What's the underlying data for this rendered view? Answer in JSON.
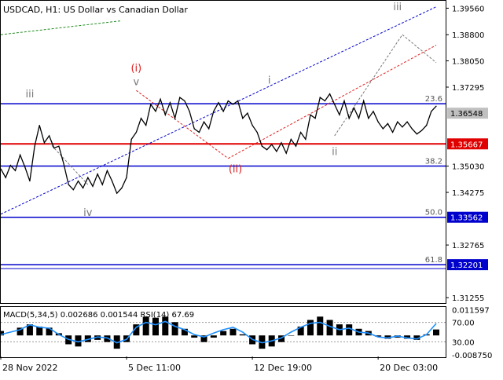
{
  "header": {
    "symbol_line": "USDCAD, H1:  US Dollar vs Canadian Dollar"
  },
  "colors": {
    "price_line": "#000000",
    "red_level": "#e00000",
    "blue_level": "#0000cc",
    "wave_red": "#dd2222",
    "wave_grey": "#777777",
    "channel_blue": "#0000cc",
    "fib_label": "#555555",
    "macd_hist": "#000000",
    "rsi_line": "#1e90ff"
  },
  "chart_data": [
    {
      "type": "line",
      "title": "USDCAD, H1:  US Dollar vs Canadian Dollar",
      "ylim": [
        1.311,
        1.3975
      ],
      "xlabel": "",
      "ylabel": "",
      "grid": false,
      "y_ticks": [
        "1.39560",
        "1.38800",
        "1.38050",
        "1.37295",
        "1.36548",
        "1.35667",
        "1.35030",
        "1.34275",
        "1.33562",
        "1.32765",
        "1.32201",
        "1.31255"
      ],
      "y_tick_values": [
        1.3956,
        1.388,
        1.3805,
        1.37295,
        1.36548,
        1.35667,
        1.3503,
        1.34275,
        1.33562,
        1.32765,
        1.32201,
        1.31255
      ],
      "highlighted_prices": [
        {
          "label": "1.36548",
          "value": 1.36548,
          "style": "current",
          "color": "#c0c0c0"
        },
        {
          "label": "1.35667",
          "value": 1.35667,
          "style": "level",
          "color": "#e00000"
        },
        {
          "label": "1.33562",
          "value": 1.33562,
          "style": "level",
          "color": "#0000cc"
        },
        {
          "label": "1.32201",
          "value": 1.32201,
          "style": "level",
          "color": "#0000cc"
        }
      ],
      "x_ticks": [
        "28 Nov 2022",
        "5 Dec 11:00",
        "12 Dec 19:00",
        "20 Dec 03:00"
      ],
      "x_tick_positions": [
        0,
        0.26,
        0.52,
        0.78
      ],
      "series": [
        {
          "values": [
            [
              0.0,
              1.3495
            ],
            [
              0.01,
              1.347
            ],
            [
              0.02,
              1.3505
            ],
            [
              0.03,
              1.349
            ],
            [
              0.04,
              1.3535
            ],
            [
              0.05,
              1.35
            ],
            [
              0.06,
              1.346
            ],
            [
              0.07,
              1.356
            ],
            [
              0.08,
              1.362
            ],
            [
              0.09,
              1.357
            ],
            [
              0.1,
              1.359
            ],
            [
              0.11,
              1.3555
            ],
            [
              0.12,
              1.356
            ],
            [
              0.13,
              1.351
            ],
            [
              0.14,
              1.345
            ],
            [
              0.15,
              1.3435
            ],
            [
              0.16,
              1.346
            ],
            [
              0.17,
              1.344
            ],
            [
              0.18,
              1.347
            ],
            [
              0.19,
              1.3445
            ],
            [
              0.2,
              1.348
            ],
            [
              0.21,
              1.345
            ],
            [
              0.22,
              1.349
            ],
            [
              0.23,
              1.346
            ],
            [
              0.24,
              1.3425
            ],
            [
              0.25,
              1.344
            ],
            [
              0.26,
              1.347
            ],
            [
              0.27,
              1.358
            ],
            [
              0.28,
              1.36
            ],
            [
              0.29,
              1.364
            ],
            [
              0.3,
              1.362
            ],
            [
              0.31,
              1.368
            ],
            [
              0.32,
              1.366
            ],
            [
              0.33,
              1.3695
            ],
            [
              0.34,
              1.365
            ],
            [
              0.35,
              1.3685
            ],
            [
              0.36,
              1.364
            ],
            [
              0.37,
              1.37
            ],
            [
              0.38,
              1.369
            ],
            [
              0.39,
              1.366
            ],
            [
              0.4,
              1.361
            ],
            [
              0.41,
              1.36
            ],
            [
              0.42,
              1.363
            ],
            [
              0.43,
              1.361
            ],
            [
              0.44,
              1.366
            ],
            [
              0.45,
              1.3685
            ],
            [
              0.46,
              1.366
            ],
            [
              0.47,
              1.369
            ],
            [
              0.48,
              1.368
            ],
            [
              0.49,
              1.369
            ],
            [
              0.5,
              1.364
            ],
            [
              0.51,
              1.3655
            ],
            [
              0.52,
              1.362
            ],
            [
              0.53,
              1.36
            ],
            [
              0.54,
              1.356
            ],
            [
              0.55,
              1.355
            ],
            [
              0.56,
              1.3565
            ],
            [
              0.57,
              1.3545
            ],
            [
              0.58,
              1.357
            ],
            [
              0.59,
              1.354
            ],
            [
              0.6,
              1.358
            ],
            [
              0.61,
              1.356
            ],
            [
              0.62,
              1.36
            ],
            [
              0.63,
              1.358
            ],
            [
              0.64,
              1.365
            ],
            [
              0.65,
              1.364
            ],
            [
              0.66,
              1.37
            ],
            [
              0.67,
              1.369
            ],
            [
              0.68,
              1.371
            ],
            [
              0.69,
              1.368
            ],
            [
              0.7,
              1.365
            ],
            [
              0.71,
              1.369
            ],
            [
              0.72,
              1.364
            ],
            [
              0.73,
              1.367
            ],
            [
              0.74,
              1.364
            ],
            [
              0.75,
              1.369
            ],
            [
              0.76,
              1.364
            ],
            [
              0.77,
              1.366
            ],
            [
              0.78,
              1.363
            ],
            [
              0.79,
              1.361
            ],
            [
              0.8,
              1.3625
            ],
            [
              0.81,
              1.36
            ],
            [
              0.82,
              1.363
            ],
            [
              0.83,
              1.3615
            ],
            [
              0.84,
              1.363
            ],
            [
              0.85,
              1.361
            ],
            [
              0.86,
              1.3595
            ],
            [
              0.87,
              1.3605
            ],
            [
              0.88,
              1.362
            ],
            [
              0.89,
              1.366
            ],
            [
              0.9,
              1.3675
            ]
          ]
        }
      ],
      "fib_levels": [
        {
          "label": "23.6",
          "value": 1.3682
        },
        {
          "label": "38.2",
          "value": 1.3503
        },
        {
          "label": "50.0",
          "value": 1.33562
        },
        {
          "label": "61.8",
          "value": 1.32201
        }
      ],
      "horizontal_levels": [
        {
          "value": 1.35667,
          "color": "#e00000"
        },
        {
          "value": 1.33562,
          "color": "#0000cc"
        },
        {
          "value": 1.32201,
          "color": "#0000cc"
        },
        {
          "value": 1.3682,
          "color": "#0000cc"
        },
        {
          "value": 1.3503,
          "color": "#0000cc"
        }
      ],
      "wave_labels": [
        {
          "text": "iii",
          "x": 0.06,
          "y": 1.37,
          "color": "#777777"
        },
        {
          "text": "iv",
          "x": 0.18,
          "y": 1.336,
          "color": "#777777"
        },
        {
          "text": "(i)",
          "x": 0.28,
          "y": 1.3775,
          "color": "#dd2222"
        },
        {
          "text": "v",
          "x": 0.28,
          "y": 1.3735,
          "color": "#777777"
        },
        {
          "text": "(ii)",
          "x": 0.485,
          "y": 1.3485,
          "color": "#dd2222"
        },
        {
          "text": "i",
          "x": 0.555,
          "y": 1.374,
          "color": "#777777"
        },
        {
          "text": "ii",
          "x": 0.69,
          "y": 1.3535,
          "color": "#777777"
        },
        {
          "text": "iii",
          "x": 0.82,
          "y": 1.395,
          "color": "#777777"
        }
      ],
      "trend_lines": [
        {
          "from": [
            0.0,
            1.3365
          ],
          "to": [
            0.9,
            1.396
          ],
          "color": "#0000cc",
          "dash": true
        },
        {
          "from": [
            0.47,
            1.3525
          ],
          "to": [
            0.9,
            1.385
          ],
          "color": "#dd2222",
          "dash": true
        },
        {
          "from": [
            0.0,
            1.388
          ],
          "to": [
            0.25,
            1.392
          ],
          "color": "#228b22",
          "dash": true
        },
        {
          "from": [
            0.28,
            1.372
          ],
          "to": [
            0.47,
            1.3525
          ],
          "color": "#dd2222",
          "dash": true
        },
        {
          "from": [
            0.69,
            1.359
          ],
          "to": [
            0.83,
            1.388
          ],
          "color": "#777777",
          "dash": true
        },
        {
          "from": [
            0.83,
            1.388
          ],
          "to": [
            0.9,
            1.38
          ],
          "color": "#777777",
          "dash": true
        },
        {
          "from": [
            0.1,
            1.357
          ],
          "to": [
            0.18,
            1.345
          ],
          "color": "#777777",
          "dash": true
        }
      ]
    },
    {
      "type": "line",
      "title": "MACD(5,34,5) 0.002686 0.001544 RSI(14) 67.69",
      "ylim": [
        -0.0095,
        0.0125
      ],
      "y_ticks": [
        "0.011597",
        "70.00",
        "30.00",
        "-0.008750"
      ],
      "rsi_levels": [
        70,
        30
      ],
      "series": [
        {
          "name": "RSI(14)",
          "values": [
            [
              0.0,
              45
            ],
            [
              0.04,
              55
            ],
            [
              0.06,
              65
            ],
            [
              0.08,
              60
            ],
            [
              0.1,
              58
            ],
            [
              0.12,
              45
            ],
            [
              0.14,
              35
            ],
            [
              0.16,
              30
            ],
            [
              0.18,
              35
            ],
            [
              0.2,
              40
            ],
            [
              0.22,
              38
            ],
            [
              0.24,
              28
            ],
            [
              0.26,
              35
            ],
            [
              0.28,
              60
            ],
            [
              0.3,
              70
            ],
            [
              0.32,
              65
            ],
            [
              0.34,
              72
            ],
            [
              0.36,
              62
            ],
            [
              0.38,
              55
            ],
            [
              0.4,
              45
            ],
            [
              0.42,
              40
            ],
            [
              0.44,
              48
            ],
            [
              0.46,
              55
            ],
            [
              0.48,
              60
            ],
            [
              0.5,
              50
            ],
            [
              0.52,
              35
            ],
            [
              0.54,
              28
            ],
            [
              0.56,
              32
            ],
            [
              0.58,
              38
            ],
            [
              0.6,
              50
            ],
            [
              0.62,
              60
            ],
            [
              0.64,
              68
            ],
            [
              0.66,
              70
            ],
            [
              0.68,
              62
            ],
            [
              0.7,
              55
            ],
            [
              0.72,
              58
            ],
            [
              0.74,
              50
            ],
            [
              0.76,
              48
            ],
            [
              0.78,
              40
            ],
            [
              0.8,
              38
            ],
            [
              0.82,
              42
            ],
            [
              0.84,
              38
            ],
            [
              0.86,
              36
            ],
            [
              0.88,
              45
            ],
            [
              0.9,
              67.69
            ]
          ]
        },
        {
          "name": "MACD(5,34,5)",
          "values": [
            [
              0.0,
              0.002
            ],
            [
              0.04,
              0.0035
            ],
            [
              0.06,
              0.005
            ],
            [
              0.08,
              0.004
            ],
            [
              0.1,
              0.0035
            ],
            [
              0.12,
              0.001
            ],
            [
              0.14,
              -0.004
            ],
            [
              0.16,
              -0.005
            ],
            [
              0.18,
              -0.003
            ],
            [
              0.2,
              -0.002
            ],
            [
              0.22,
              -0.003
            ],
            [
              0.24,
              -0.006
            ],
            [
              0.26,
              -0.003
            ],
            [
              0.28,
              0.005
            ],
            [
              0.3,
              0.0085
            ],
            [
              0.32,
              0.008
            ],
            [
              0.34,
              0.0085
            ],
            [
              0.36,
              0.006
            ],
            [
              0.38,
              0.003
            ],
            [
              0.4,
              -0.001
            ],
            [
              0.42,
              -0.003
            ],
            [
              0.44,
              -0.001
            ],
            [
              0.46,
              0.002
            ],
            [
              0.48,
              0.003
            ],
            [
              0.5,
              0.0005
            ],
            [
              0.52,
              -0.004
            ],
            [
              0.54,
              -0.006
            ],
            [
              0.56,
              -0.005
            ],
            [
              0.58,
              -0.003
            ],
            [
              0.6,
              0.0
            ],
            [
              0.62,
              0.004
            ],
            [
              0.64,
              0.007
            ],
            [
              0.66,
              0.0085
            ],
            [
              0.68,
              0.007
            ],
            [
              0.7,
              0.005
            ],
            [
              0.72,
              0.005
            ],
            [
              0.74,
              0.003
            ],
            [
              0.76,
              0.002
            ],
            [
              0.78,
              -0.0005
            ],
            [
              0.8,
              -0.0015
            ],
            [
              0.82,
              -0.001
            ],
            [
              0.84,
              -0.0015
            ],
            [
              0.86,
              -0.002
            ],
            [
              0.88,
              0.0005
            ],
            [
              0.9,
              0.002686
            ]
          ]
        }
      ]
    }
  ]
}
